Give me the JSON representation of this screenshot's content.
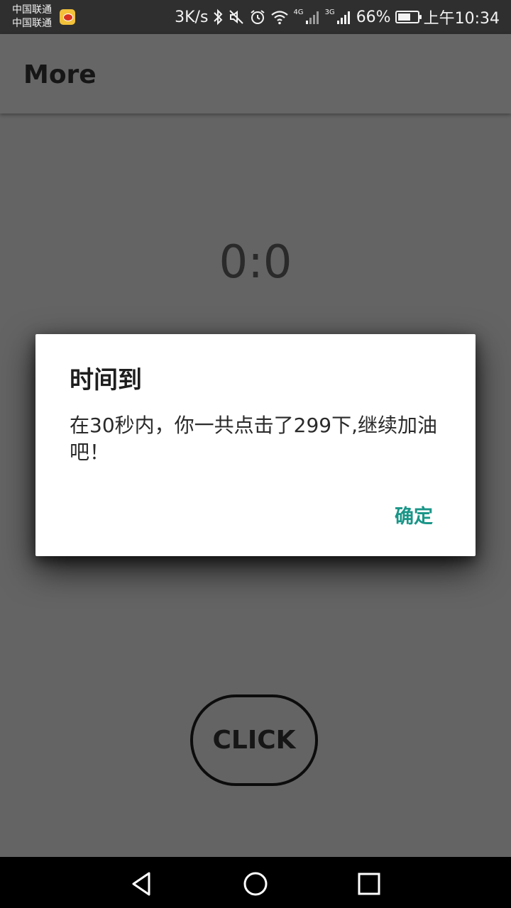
{
  "status_bar": {
    "carrier_1": "中国联通",
    "carrier_2": "中国联通",
    "app_notification_icon": "weibo-icon",
    "net_speed": "3K/s",
    "signal_1_type": "4G",
    "signal_2_type": "3G",
    "battery_percent": "66%",
    "battery_level": 0.66,
    "time": "上午10:34"
  },
  "app_bar": {
    "title": "More"
  },
  "main": {
    "score": "0:0",
    "click_label": "CLICK"
  },
  "dialog": {
    "title": "时间到",
    "message": "在30秒内，你一共点击了299下,继续加油吧！",
    "confirm_label": "确定"
  },
  "colors": {
    "accent": "#1a9688",
    "status_bar": "#2f2f2f",
    "scrim_background": "#646464",
    "nav_bar": "#000000"
  },
  "nav_bar": {
    "back_icon": "back-triangle-icon",
    "home_icon": "home-circle-icon",
    "recents_icon": "recents-square-icon"
  }
}
